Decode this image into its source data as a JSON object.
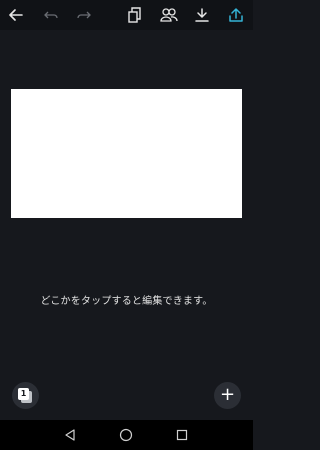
{
  "toolbar": {
    "back_icon": "arrow-left-icon",
    "undo_icon": "undo-icon",
    "redo_icon": "redo-icon",
    "pages_icon": "copy-pages-icon",
    "share_people_icon": "people-icon",
    "download_icon": "download-icon",
    "upload_icon": "upload-icon",
    "accent_color": "#34b3d6"
  },
  "main": {
    "hint_text": "どこかをタップすると編集できます。"
  },
  "bottom": {
    "page_number": "1",
    "add_label": "+"
  },
  "system_nav": {
    "back_icon": "triangle-back-icon",
    "home_icon": "circle-home-icon",
    "recents_icon": "square-recents-icon"
  }
}
